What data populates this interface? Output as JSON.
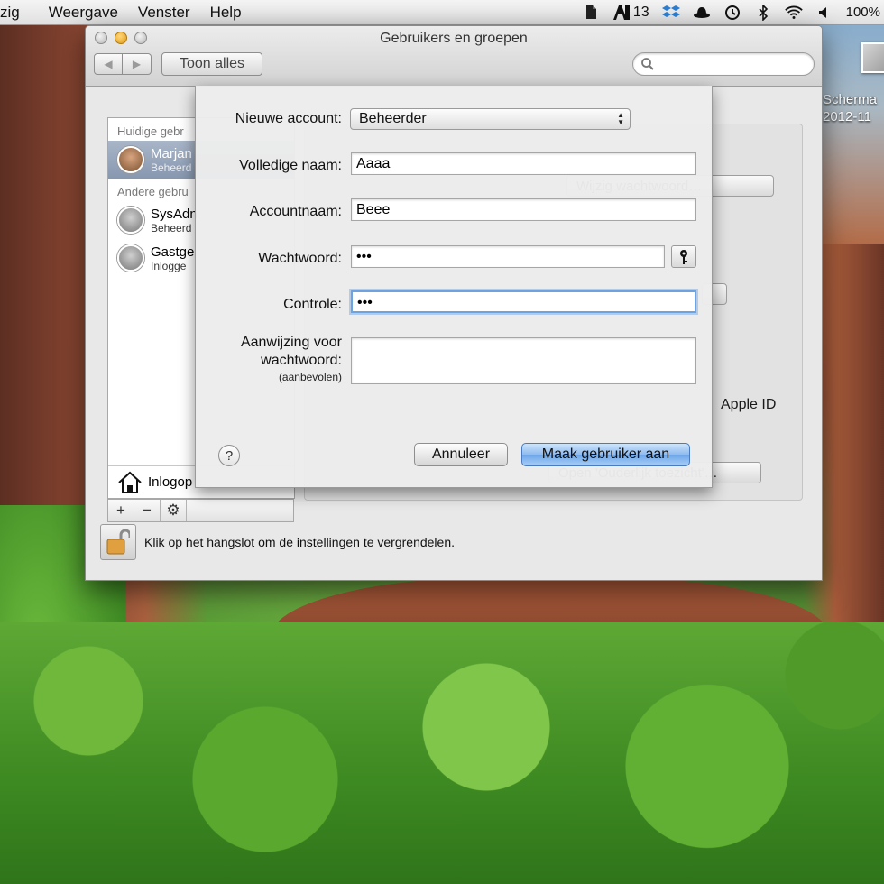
{
  "menubar": {
    "items": [
      "zig",
      "Weergave",
      "Venster",
      "Help"
    ],
    "status": {
      "evernote_icon": "evernote-icon",
      "adobe_badge": "13",
      "battery_text": "100%"
    }
  },
  "desktop": {
    "label_line1": "Scherma",
    "label_line2": "2012-11"
  },
  "window": {
    "title": "Gebruikers en groepen",
    "back_label": "◀",
    "forward_label": "▶",
    "show_all_label": "Toon alles",
    "search_placeholder": ""
  },
  "userlist": {
    "current_header": "Huidige gebr",
    "current_user": {
      "name": "Marjan",
      "role": "Beheerd"
    },
    "other_header": "Andere gebru",
    "others": [
      {
        "name": "SysAdn",
        "role": "Beheerd"
      },
      {
        "name": "Gastge",
        "role": "Inlogge"
      }
    ],
    "login_label": "Inlogop",
    "add_label": "+",
    "remove_label": "−",
    "gear_label": "⚙"
  },
  "detail": {
    "change_password_label": "Wijzig wachtwoord…",
    "apple_id_tail": "Apple ID",
    "parental_button_label": "Open 'Ouderlijk toezicht'…"
  },
  "footer": {
    "lock_text": "Klik op het hangslot om de instellingen te vergrendelen.",
    "help_label": "?"
  },
  "sheet": {
    "new_account_label": "Nieuwe account:",
    "new_account_value": "Beheerder",
    "fullname_label": "Volledige naam:",
    "fullname_value": "Aaaa",
    "account_label": "Accountnaam:",
    "account_value": "Beee",
    "password_label": "Wachtwoord:",
    "password_value": "•••",
    "verify_label": "Controle:",
    "verify_value": "•••",
    "hint_label_line1": "Aanwijzing voor",
    "hint_label_line2": "wachtwoord:",
    "hint_label_sub": "(aanbevolen)",
    "hint_value": "",
    "help_label": "?",
    "cancel_label": "Annuleer",
    "create_label": "Maak gebruiker aan"
  }
}
